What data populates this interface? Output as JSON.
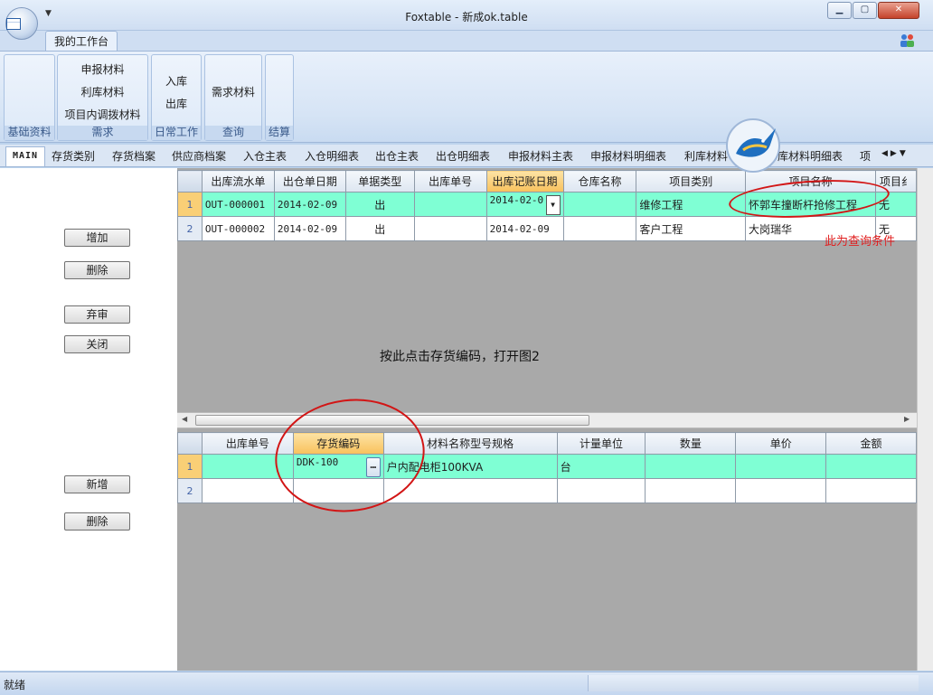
{
  "window": {
    "title": "Foxtable - 新成ok.table",
    "min_glyph": "▁",
    "max_glyph": "▢",
    "close_glyph": "✕"
  },
  "ribbon": {
    "tab": "我的工作台",
    "groups": [
      {
        "caption": "基础资料",
        "buttons": []
      },
      {
        "caption": "需求",
        "buttons": [
          "申报材料",
          "利库材料",
          "项目内调拨材料"
        ]
      },
      {
        "caption": "日常工作",
        "buttons": [
          "入库",
          "出库"
        ]
      },
      {
        "caption": "查询",
        "buttons": [
          "需求材料"
        ]
      },
      {
        "caption": "结算",
        "buttons": []
      }
    ]
  },
  "table_tabs": [
    "MAIN",
    "存货类别",
    "存货档案",
    "供应商档案",
    "入仓主表",
    "入仓明细表",
    "出仓主表",
    "出仓明细表",
    "申报材料主表",
    "申报材料明细表",
    "利库材料",
    "库材料明细表",
    "项"
  ],
  "side_buttons": {
    "add": "增加",
    "delete_top": "删除",
    "abandon": "弃审",
    "close": "关闭",
    "new": "新增",
    "delete_bottom": "删除"
  },
  "top_grid": {
    "columns": [
      "出库流水单",
      "出仓单日期",
      "单据类型",
      "出库单号",
      "出库记账日期",
      "仓库名称",
      "项目类别",
      "项目名称",
      "项目纟"
    ],
    "rows": [
      {
        "num": "1",
        "cells": [
          "OUT-000001",
          "2014-02-09",
          "出",
          "",
          "2014-02-0",
          "",
          "维修工程",
          "怀郭车撞断杆抢修工程",
          "无"
        ]
      },
      {
        "num": "2",
        "cells": [
          "OUT-000002",
          "2014-02-09",
          "出",
          "",
          "2014-02-09",
          "",
          "客户工程",
          "大岗瑞华",
          "无"
        ]
      }
    ]
  },
  "bottom_grid": {
    "columns": [
      "出库单号",
      "存货编码",
      "材料名称型号规格",
      "计量单位",
      "数量",
      "单价",
      "金额"
    ],
    "rows": [
      {
        "num": "1",
        "cells": [
          "",
          "DDK-100",
          "户内配电柜100KVA",
          "台",
          "",
          "",
          ""
        ]
      },
      {
        "num": "2",
        "cells": [
          "",
          "",
          "",
          "",
          "",
          "",
          ""
        ]
      }
    ]
  },
  "annotations": {
    "open_hint": "按此点击存货编码，打开图2",
    "query_hint": "此为查询条件"
  },
  "status": {
    "text": "就绪"
  },
  "colors": {
    "current_row": "#7fffd4",
    "annotation": "#d21515"
  }
}
